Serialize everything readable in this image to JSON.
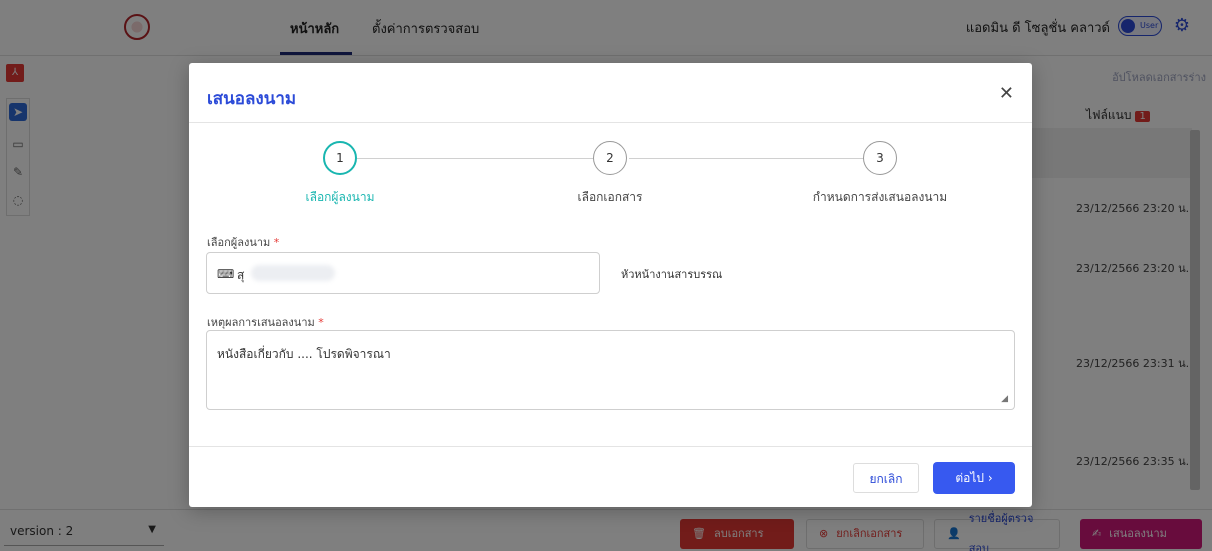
{
  "header": {
    "nav": [
      "หน้าหลัก",
      "ตั้งค่าการตรวจสอบ"
    ],
    "user_name": "แอดมิน ดี โซลูชั่น คลาวด์",
    "toggle_label": "User"
  },
  "sidebar": {
    "pdf_label": "⅄"
  },
  "right_panel": {
    "upload_label": "อัปโหลดเอกสารร่าง",
    "attachments_label": "ไฟล์แนบ",
    "attachments_count": "1",
    "dates": [
      "23/12/2566 23:20 น.",
      "23/12/2566 23:20 น.",
      "23/12/2566 23:31 น.",
      "23/12/2566 23:35 น."
    ]
  },
  "bottom": {
    "version": "version : 2",
    "delete_label": "ลบเอกสาร",
    "cancel_doc_label": "ยกเลิกเอกสาร",
    "reviewers_label": "รายชื่อผู้ตรวจสอบ",
    "propose_label": "เสนอลงนาม"
  },
  "modal": {
    "title": "เสนอลงนาม",
    "steps": [
      {
        "number": "1",
        "label": "เลือกผู้ลงนาม"
      },
      {
        "number": "2",
        "label": "เลือกเอกสาร"
      },
      {
        "number": "3",
        "label": "กำหนดการส่งเสนอลงนาม"
      }
    ],
    "signer_label": "เลือกผู้ลงนาม",
    "signer_value": "สุ",
    "signer_position": "หัวหน้างานสารบรรณ",
    "reason_label": "เหตุผลการเสนอลงนาม",
    "reason_value": "หนังสือเกี่ยวกับ .... โปรดพิจารณา",
    "required_mark": "*",
    "cancel_label": "ยกเลิก",
    "next_label": "ต่อไป ›"
  }
}
